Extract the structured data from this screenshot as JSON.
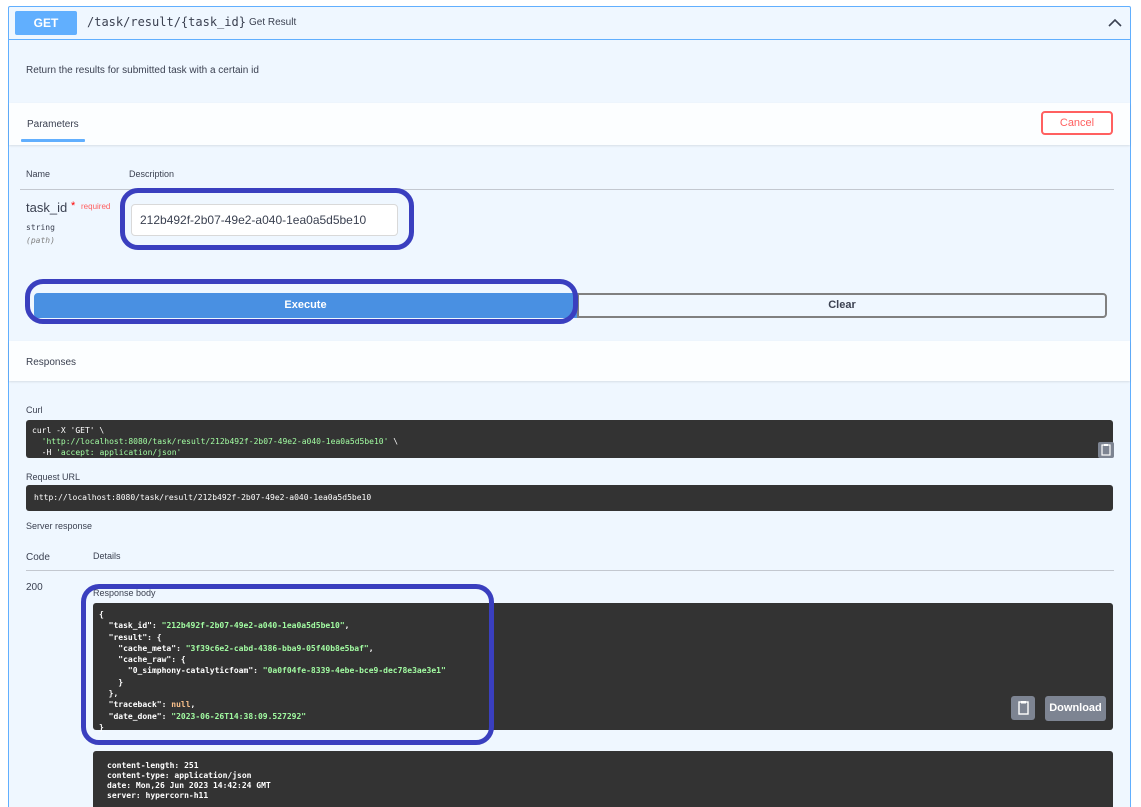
{
  "operation": {
    "method": "GET",
    "path": "/task/result/{task_id}",
    "summary": "Get Result",
    "description": "Return the results for submitted task with a certain id"
  },
  "parameters": {
    "tab_label": "Parameters",
    "cancel_label": "Cancel",
    "col_name": "Name",
    "col_description": "Description",
    "items": [
      {
        "name": "task_id",
        "required_star": "*",
        "required_label": "required",
        "type": "string",
        "in": "(path)",
        "value": "212b492f-2b07-49e2-a040-1ea0a5d5be10"
      }
    ]
  },
  "actions": {
    "execute_label": "Execute",
    "clear_label": "Clear"
  },
  "responses": {
    "title": "Responses",
    "curl_label": "Curl",
    "curl_lines": [
      "curl -X 'GET' \\",
      "  'http://localhost:8080/task/result/212b492f-2b07-49e2-a040-1ea0a5d5be10' \\",
      "  -H 'accept: application/json'"
    ],
    "request_url_label": "Request URL",
    "request_url": "http://localhost:8080/task/result/212b492f-2b07-49e2-a040-1ea0a5d5be10",
    "server_response_label": "Server response",
    "code_label": "Code",
    "details_label": "Details",
    "status_code": "200",
    "response_body_label": "Response body",
    "body": {
      "task_id": "212b492f-2b07-49e2-a040-1ea0a5d5be10",
      "cache_meta": "3f39c6e2-cabd-4386-bba9-05f40b8e5baf",
      "cache_raw_key": "0_simphony-catalyticfoam",
      "cache_raw_value": "0a0f04fe-8339-4ebe-bce9-dec78e3ae3e1",
      "traceback": "null",
      "date_done": "2023-06-26T14:38:09.527292"
    },
    "download_label": "Download",
    "headers": [
      "content-length: 251",
      "content-type: application/json",
      "date: Mon,26 Jun 2023 14:42:24 GMT",
      "server: hypercorn-h11"
    ]
  },
  "colors": {
    "get_accent": "#61affe",
    "execute_blue": "#4990e2",
    "cancel_red": "#ff6060",
    "highlight": "#3a3fbf"
  }
}
